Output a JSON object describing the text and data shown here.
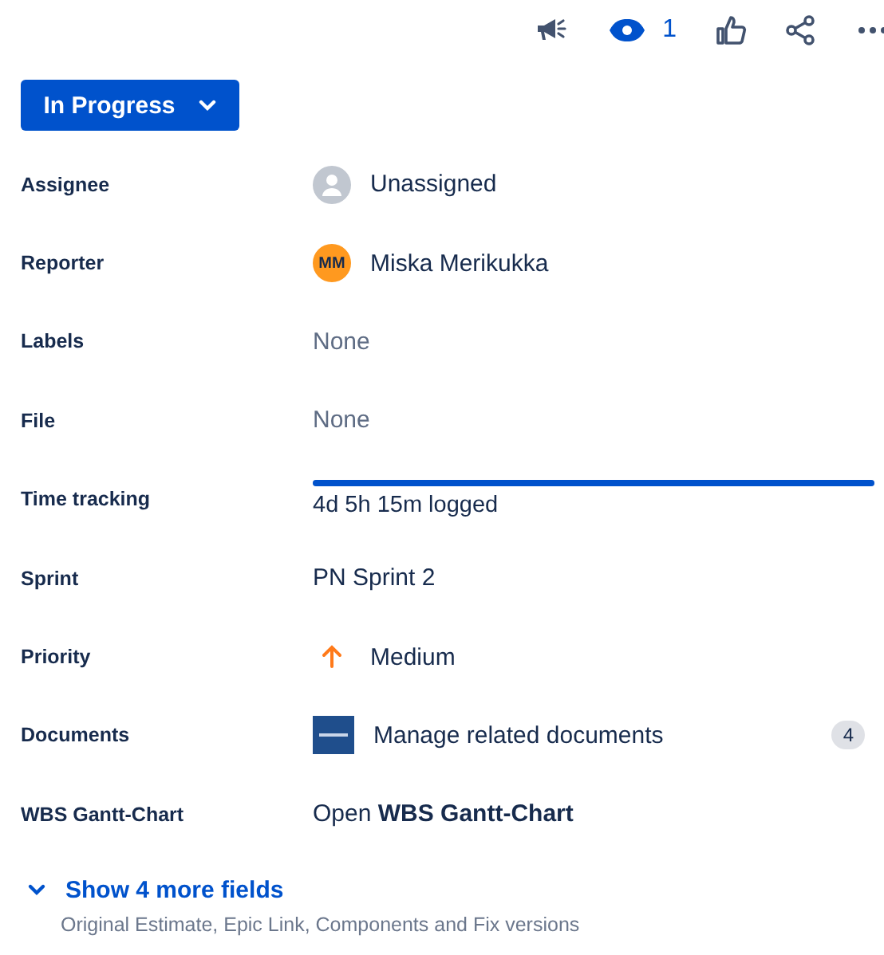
{
  "toolbar": {
    "watchers": "1"
  },
  "status_button": {
    "label": "In Progress"
  },
  "fields": [
    {
      "label": "Assignee",
      "kind": "empty-avatar",
      "value": "Unassigned"
    },
    {
      "label": "Reporter",
      "kind": "avatar",
      "initials": "MM",
      "value": "Miska Merikukka"
    },
    {
      "label": "Labels",
      "kind": "muted",
      "value": "None"
    },
    {
      "label": "File",
      "kind": "muted",
      "value": "None"
    },
    {
      "label": "Time tracking",
      "kind": "progress",
      "level": 1,
      "value": "4d 5h 15m logged"
    },
    {
      "label": "Sprint",
      "kind": "plain",
      "value": "PN Sprint 2"
    },
    {
      "label": "Priority",
      "kind": "priority",
      "value": "Medium"
    },
    {
      "label": "Documents",
      "kind": "documents",
      "value": "Manage related documents",
      "count": "4"
    },
    {
      "label": "WBS Gantt-Chart",
      "kind": "rich",
      "value": "Open **WBS Gantt-Chart**"
    }
  ],
  "more": {
    "label": "Show 4 more fields",
    "hint": "Original Estimate, Epic Link, Components and Fix versions"
  }
}
